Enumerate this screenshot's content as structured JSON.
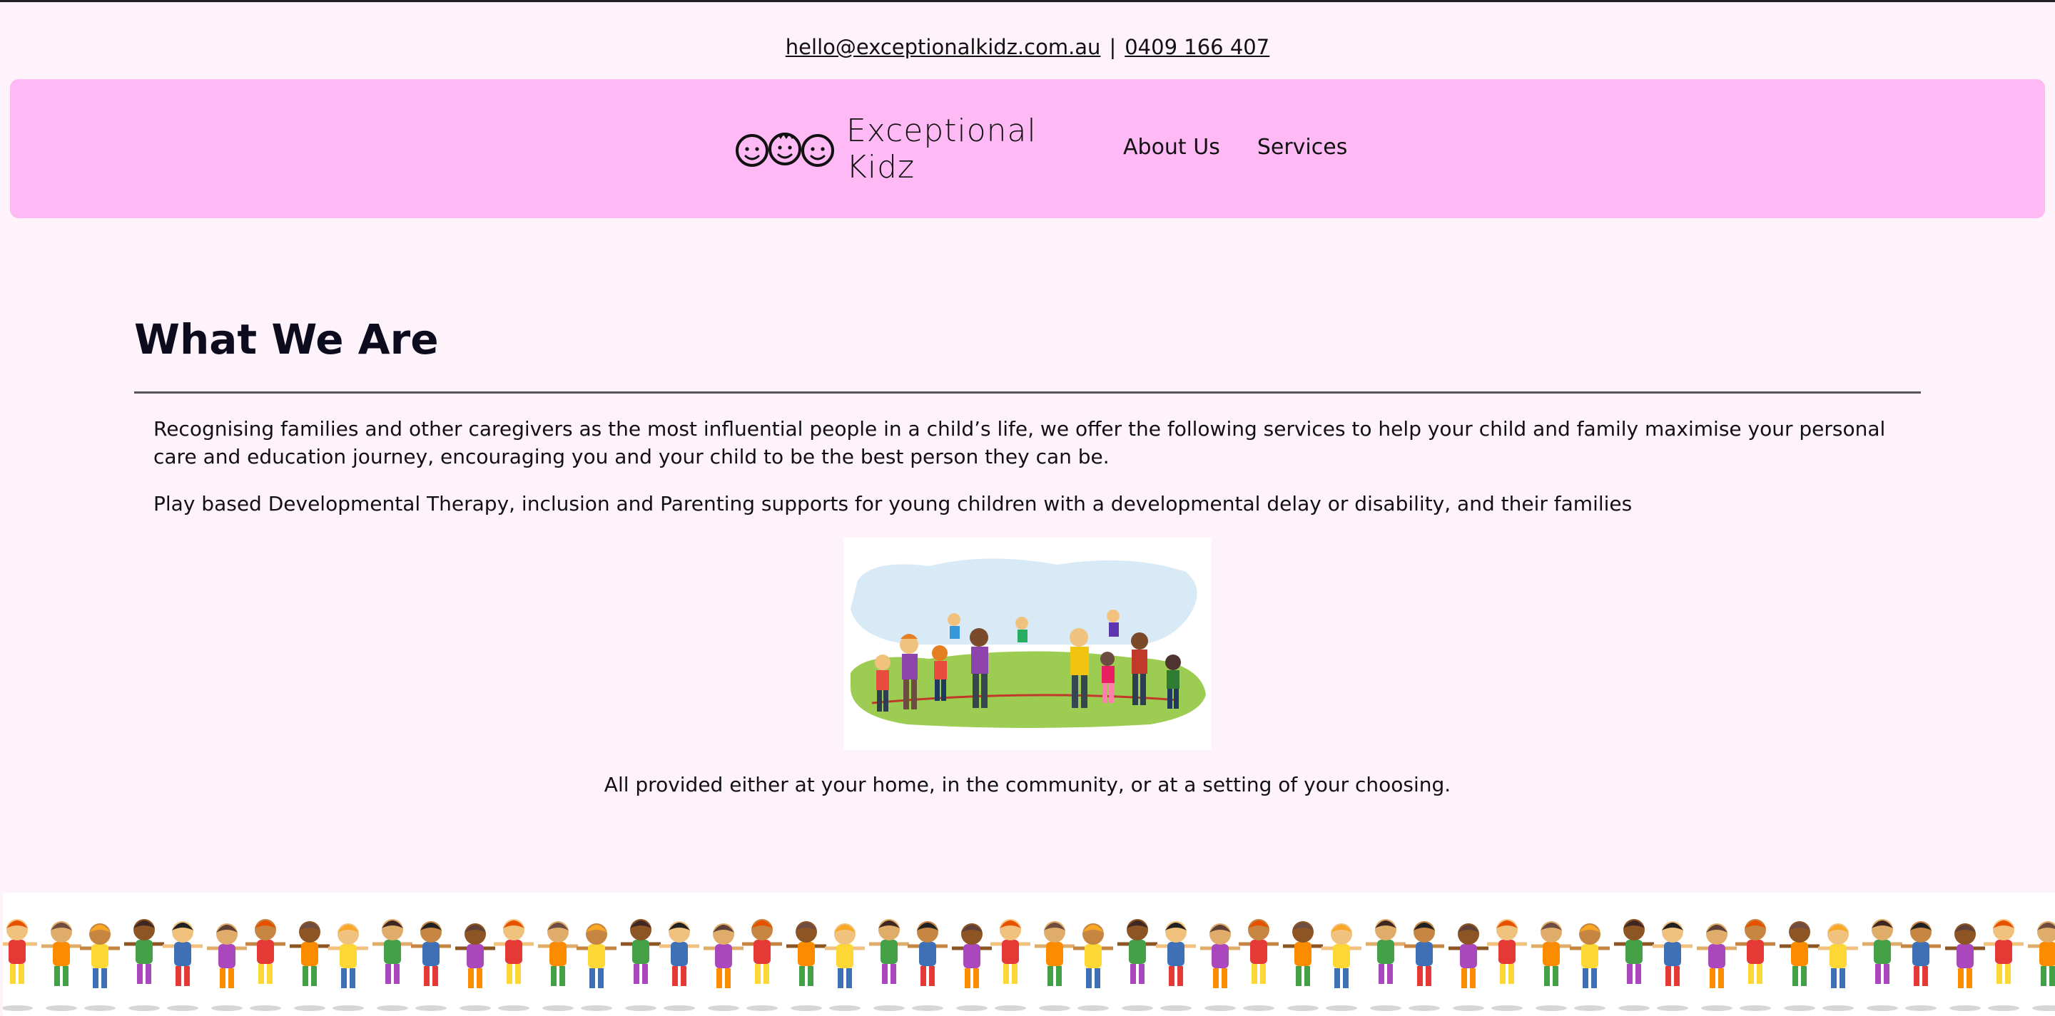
{
  "contact": {
    "email": "hello@exceptionalkidz.com.au",
    "separator": "|",
    "phone": "0409 166 407"
  },
  "header": {
    "brand": "Exceptional Kidz",
    "logo_icon": "three-smiling-faces-logo",
    "nav": [
      "About Us",
      "Services"
    ],
    "background": "#ffbaf6"
  },
  "main": {
    "title": "What We Are",
    "paragraphs": [
      "Recognising families and other caregivers as the most influential people in a child’s life, we offer the following services to help your child and family maximise your personal care and education journey, encouraging you and your child to be the best person they can be.",
      "Play based Developmental Therapy, inclusion and Parenting supports for young children with a developmental delay or disability, and their families"
    ],
    "caption": "All provided either at your home, in the community, or at a setting of your choosing."
  },
  "page_background": "#fff3fb"
}
